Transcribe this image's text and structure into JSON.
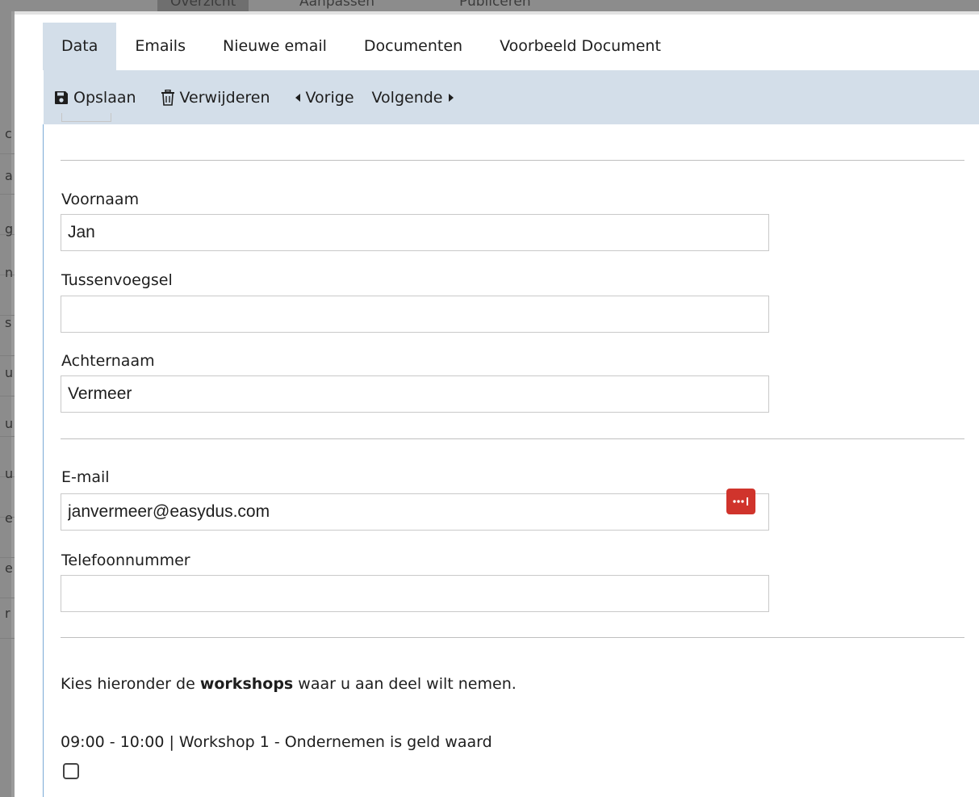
{
  "background": {
    "tabs": [
      "Overzicht",
      "Aanpassen",
      "Publiceren"
    ],
    "left_letters": [
      "c",
      "a",
      "g",
      "n",
      "s",
      "u",
      "u",
      "u",
      "e",
      "e",
      "r"
    ]
  },
  "tabs": [
    {
      "label": "Data",
      "active": true
    },
    {
      "label": "Emails"
    },
    {
      "label": "Nieuwe email"
    },
    {
      "label": "Documenten"
    },
    {
      "label": "Voorbeeld Document"
    }
  ],
  "toolbar": {
    "save_label": "Opslaan",
    "delete_label": "Verwijderen",
    "prev_label": "Vorige",
    "next_label": "Volgende"
  },
  "form": {
    "voornaam": {
      "label": "Voornaam",
      "value": "Jan"
    },
    "tussenvoegsel": {
      "label": "Tussenvoegsel",
      "value": ""
    },
    "achternaam": {
      "label": "Achternaam",
      "value": "Vermeer"
    },
    "email": {
      "label": "E-mail",
      "value": "janvermeer@easydus.com"
    },
    "telefoon": {
      "label": "Telefoonnummer",
      "value": ""
    }
  },
  "workshops": {
    "intro_before": "Kies hieronder de ",
    "intro_bold": "workshops",
    "intro_after": " waar u aan deel wilt nemen.",
    "items": [
      {
        "label": "09:00 - 10:00 | Workshop 1 - Ondernemen is geld waard",
        "checked": false
      }
    ]
  },
  "colors": {
    "accent_bar": "#d3dee9",
    "password_badge": "#d0342c"
  }
}
